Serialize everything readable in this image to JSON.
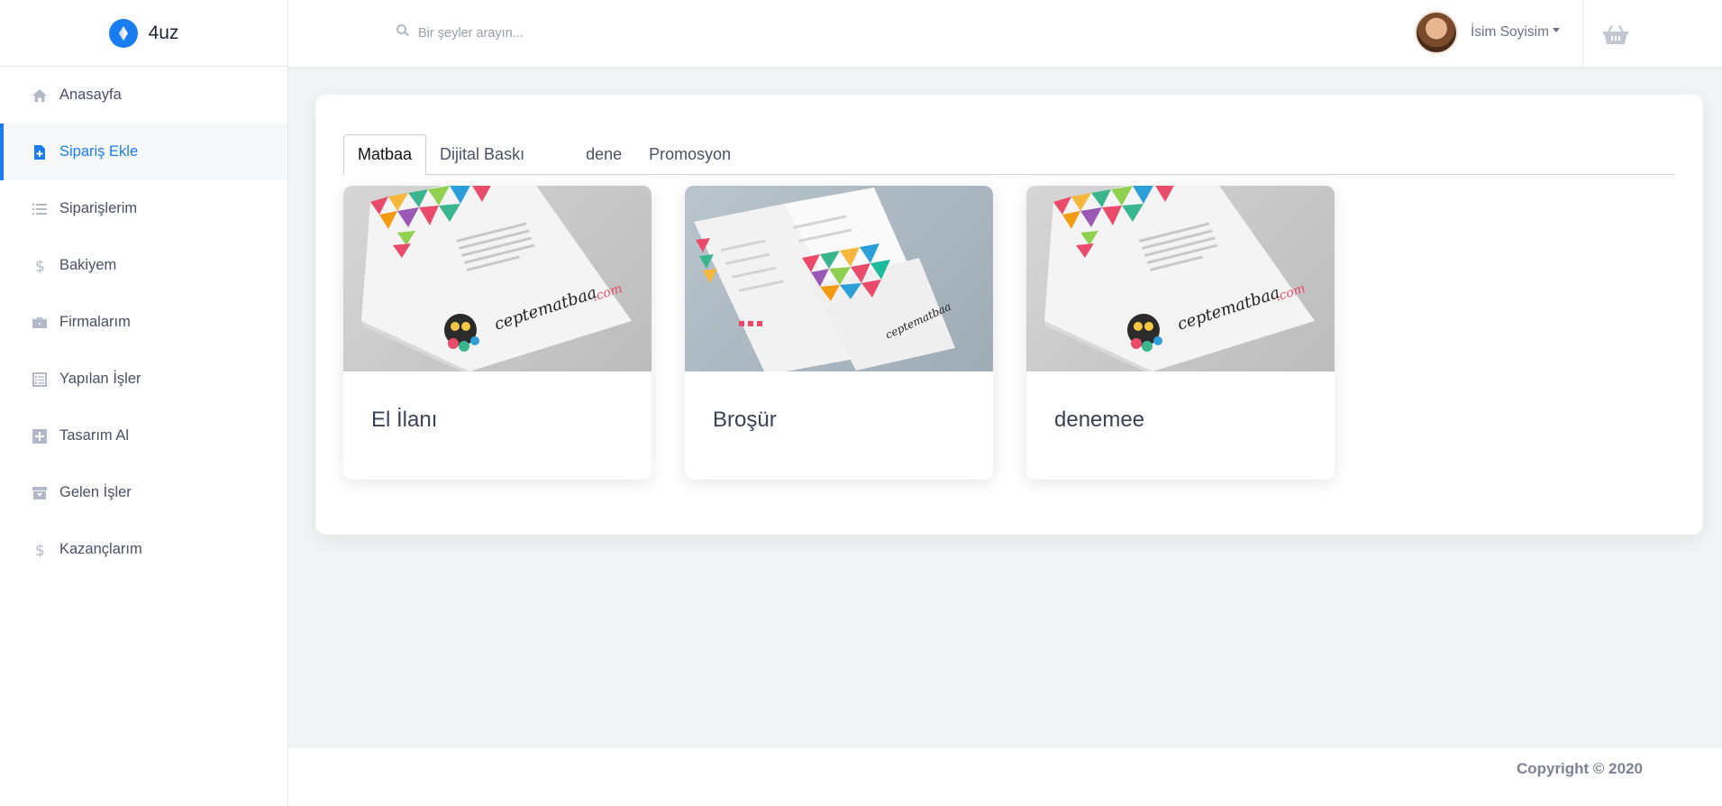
{
  "brand": {
    "name": "4uz",
    "icon": "logo-icon",
    "accent": "#1a7cf1"
  },
  "sidebar": {
    "items": [
      {
        "label": "Anasayfa",
        "icon": "home-icon"
      },
      {
        "label": "Sipariş Ekle",
        "icon": "file-plus-icon",
        "active": true
      },
      {
        "label": "Siparişlerim",
        "icon": "list-icon"
      },
      {
        "label": "Bakiyem",
        "icon": "dollar-icon"
      },
      {
        "label": "Firmalarım",
        "icon": "briefcase-icon"
      },
      {
        "label": "Yapılan İşler",
        "icon": "checklist-icon"
      },
      {
        "label": "Tasarım Al",
        "icon": "plus-square-icon"
      },
      {
        "label": "Gelen İşler",
        "icon": "inbox-icon"
      },
      {
        "label": "Kazançlarım",
        "icon": "dollar-icon"
      }
    ]
  },
  "header": {
    "search_placeholder": "Bir şeyler arayın...",
    "user_name": "İsim Soyisim"
  },
  "tabs": [
    {
      "label": "Matbaa",
      "active": true
    },
    {
      "label": "Dijital Baskı"
    },
    {
      "label": "dene"
    },
    {
      "label": "Promosyon"
    }
  ],
  "products": [
    {
      "title": "El İlanı",
      "image": "flyer"
    },
    {
      "title": "Broşür",
      "image": "brochure"
    },
    {
      "title": "denemee",
      "image": "flyer"
    }
  ],
  "footer": {
    "copyright": "Copyright © 2020"
  }
}
